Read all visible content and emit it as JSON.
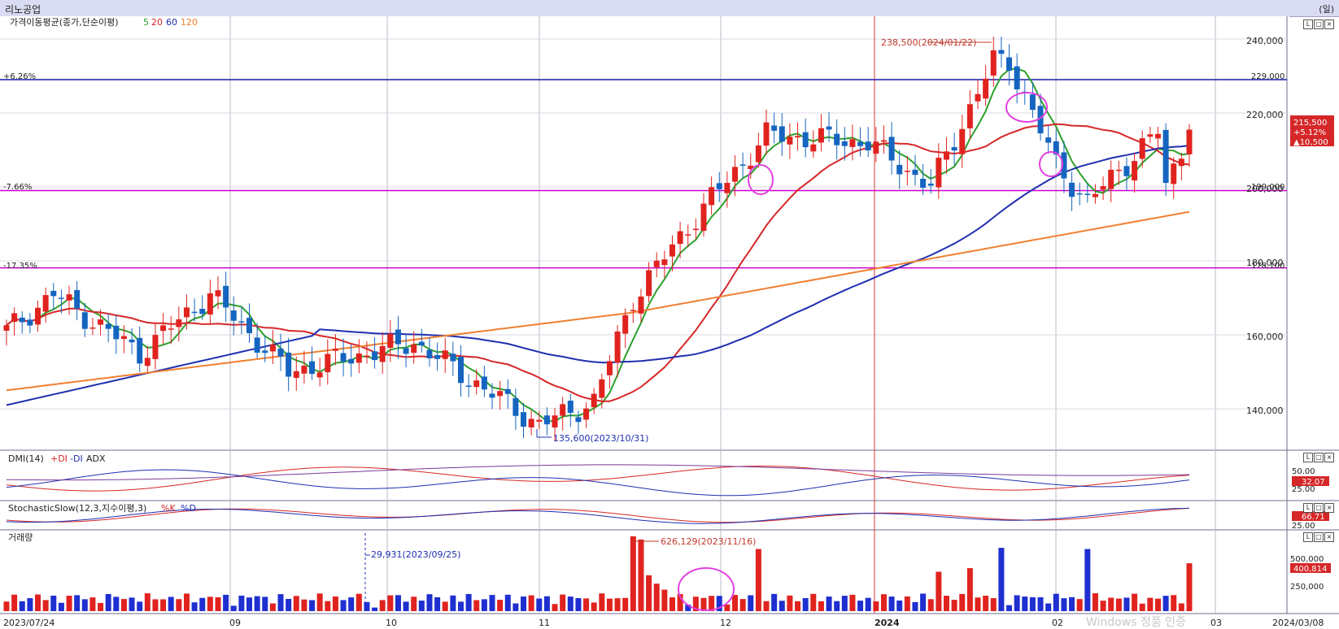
{
  "window": {
    "title": "리노공업",
    "right_label": "(일)"
  },
  "price_panel": {
    "legend_title": "가격이동평균(종가,단순이평)",
    "ma_labels": [
      "5",
      "20",
      "60",
      "120"
    ],
    "ma_colors": [
      "#2ca02c",
      "#d62728",
      "#1f2fb0",
      "#f08030"
    ],
    "y_ticks": [
      "240,000",
      "220,000",
      "200,000",
      "180,000",
      "160,000",
      "140,000"
    ],
    "hlines": [
      {
        "left_label": "+6.26%",
        "right_label": "229,000",
        "value": 229000,
        "color": "#1a1aa8"
      },
      {
        "left_label": "-7.66%",
        "right_label": "199,000",
        "value": 199000,
        "color": "#cc00cc"
      },
      {
        "left_label": "-17.35%",
        "right_label": "178,100",
        "value": 178100,
        "color": "#cc00cc"
      }
    ],
    "high_annotation": "238,500(2024/01/22)",
    "low_annotation": "135,600(2023/10/31)",
    "current_badge": {
      "price": "215,500",
      "change_pct": "+5.12%",
      "change_abs": "▲10,500"
    }
  },
  "dmi_panel": {
    "title": "DMI(14)",
    "plus_di": "+DI",
    "minus_di": "-DI",
    "adx": "ADX",
    "y_ticks": [
      "50.00",
      "25.00"
    ],
    "current": "32.07"
  },
  "stoch_panel": {
    "title": "StochasticSlow(12,3,지수이평,3)",
    "k": "%K",
    "d": "%D",
    "y_ticks": [
      "25.00"
    ],
    "current": "66.71"
  },
  "volume_panel": {
    "title": "거래량",
    "y_ticks": [
      "500,000",
      "250,000"
    ],
    "current": "400,814",
    "max_annotation": "626,129(2023/11/16)",
    "min_annotation": "29,931(2023/09/25)"
  },
  "x_axis": {
    "labels": [
      "2023/07/24",
      "09",
      "10",
      "11",
      "12",
      "2024",
      "02",
      "03",
      "2024/03/08"
    ]
  },
  "watermark": "Windows 정품 인증",
  "chart_data": {
    "type": "candlestick",
    "title": "리노공업",
    "x_range": [
      "2023/07/24",
      "2024/03/08"
    ],
    "ylim": [
      130000,
      245000
    ],
    "moving_averages": [
      "5",
      "20",
      "60",
      "120"
    ],
    "ohlc_summary": [
      {
        "date": "2023/07/24",
        "close": 161000
      },
      {
        "date": "2023/08/01",
        "close": 171000
      },
      {
        "date": "2023/08/16",
        "close": 155000
      },
      {
        "date": "2023/08/28",
        "close": 171000
      },
      {
        "date": "2023/09/12",
        "close": 150000
      },
      {
        "date": "2023/10/05",
        "close": 158000
      },
      {
        "date": "2023/10/31",
        "close": 135600,
        "low": true
      },
      {
        "date": "2023/11/10",
        "close": 142000
      },
      {
        "date": "2023/11/16",
        "close": 170000
      },
      {
        "date": "2023/11/28",
        "close": 192000
      },
      {
        "date": "2023/12/11",
        "close": 214000
      },
      {
        "date": "2023/12/28",
        "close": 212000
      },
      {
        "date": "2024/01/10",
        "close": 200000
      },
      {
        "date": "2024/01/22",
        "close": 238500,
        "high": true
      },
      {
        "date": "2024/02/01",
        "close": 206000
      },
      {
        "date": "2024/02/07",
        "close": 196000
      },
      {
        "date": "2024/02/20",
        "close": 215000
      },
      {
        "date": "2024/03/04",
        "close": 200000
      },
      {
        "date": "2024/03/08",
        "close": 215500
      }
    ],
    "volume": {
      "max": {
        "date": "2023/11/16",
        "value": 626129
      },
      "min": {
        "date": "2023/09/25",
        "value": 29931
      },
      "last": 400814
    }
  }
}
